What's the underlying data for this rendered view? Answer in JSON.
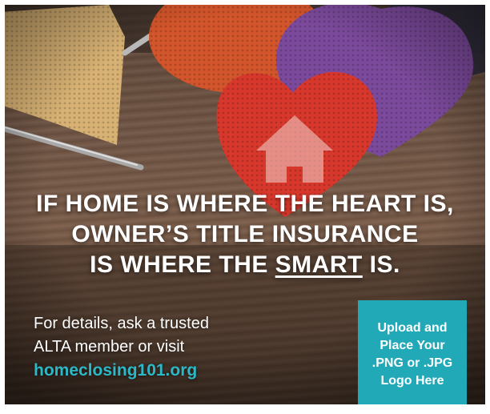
{
  "headline": {
    "line1": "IF HOME IS WHERE THE HEART IS,",
    "line2": "OWNER’S TITLE INSURANCE",
    "line3_prefix": "IS WHERE THE ",
    "line3_emphasis": "SMART",
    "line3_suffix": " IS."
  },
  "details": {
    "line1": "For details, ask a trusted",
    "line2": "ALTA member or visit",
    "url": "homeclosing101.org"
  },
  "logo_placeholder": {
    "line1": "Upload and",
    "line2": "Place Your",
    "line3": ".PNG or .JPG",
    "line4": "Logo Here"
  },
  "colors": {
    "accent_teal": "#21a9b8",
    "url_teal": "#2cb8c6",
    "heart_red": "#d8382c",
    "heart_purple": "#7c4a9c",
    "yarn_tan": "#d8b274",
    "wood_brown": "#6f5444"
  },
  "icons": {
    "house": "house-icon"
  }
}
